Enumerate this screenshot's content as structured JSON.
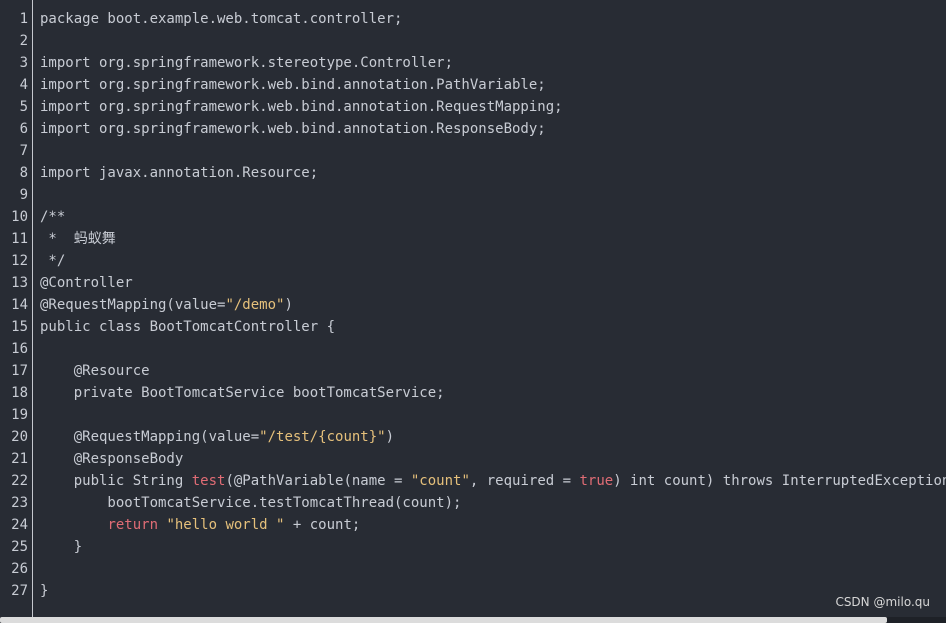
{
  "colors": {
    "background": "#282c34",
    "text": "#c8ccd4",
    "string": "#e5c07b",
    "keyword": "#e06c75",
    "gutter_border": "#c5c8ce"
  },
  "watermark": "CSDN @milo.qu",
  "lines": [
    {
      "n": "1",
      "tokens": [
        {
          "t": "package boot.example.web.tomcat.controller;",
          "c": "plain"
        }
      ]
    },
    {
      "n": "2",
      "tokens": []
    },
    {
      "n": "3",
      "tokens": [
        {
          "t": "import org.springframework.stereotype.Controller;",
          "c": "plain"
        }
      ]
    },
    {
      "n": "4",
      "tokens": [
        {
          "t": "import org.springframework.web.bind.annotation.PathVariable;",
          "c": "plain"
        }
      ]
    },
    {
      "n": "5",
      "tokens": [
        {
          "t": "import org.springframework.web.bind.annotation.RequestMapping;",
          "c": "plain"
        }
      ]
    },
    {
      "n": "6",
      "tokens": [
        {
          "t": "import org.springframework.web.bind.annotation.ResponseBody;",
          "c": "plain"
        }
      ]
    },
    {
      "n": "7",
      "tokens": []
    },
    {
      "n": "8",
      "tokens": [
        {
          "t": "import javax.annotation.Resource;",
          "c": "plain"
        }
      ]
    },
    {
      "n": "9",
      "tokens": []
    },
    {
      "n": "10",
      "tokens": [
        {
          "t": "/**",
          "c": "plain"
        }
      ]
    },
    {
      "n": "11",
      "tokens": [
        {
          "t": " *  蚂蚁舞",
          "c": "plain"
        }
      ]
    },
    {
      "n": "12",
      "tokens": [
        {
          "t": " */",
          "c": "plain"
        }
      ]
    },
    {
      "n": "13",
      "tokens": [
        {
          "t": "@Controller",
          "c": "plain"
        }
      ]
    },
    {
      "n": "14",
      "tokens": [
        {
          "t": "@RequestMapping(value=",
          "c": "plain"
        },
        {
          "t": "\"/demo\"",
          "c": "string"
        },
        {
          "t": ")",
          "c": "plain"
        }
      ]
    },
    {
      "n": "15",
      "tokens": [
        {
          "t": "public class BootTomcatController {",
          "c": "plain"
        }
      ]
    },
    {
      "n": "16",
      "tokens": []
    },
    {
      "n": "17",
      "tokens": [
        {
          "t": "    @Resource",
          "c": "plain"
        }
      ]
    },
    {
      "n": "18",
      "tokens": [
        {
          "t": "    private BootTomcatService bootTomcatService;",
          "c": "plain"
        }
      ]
    },
    {
      "n": "19",
      "tokens": []
    },
    {
      "n": "20",
      "tokens": [
        {
          "t": "    @RequestMapping(value=",
          "c": "plain"
        },
        {
          "t": "\"/test/{count}\"",
          "c": "string"
        },
        {
          "t": ")",
          "c": "plain"
        }
      ]
    },
    {
      "n": "21",
      "tokens": [
        {
          "t": "    @ResponseBody",
          "c": "plain"
        }
      ]
    },
    {
      "n": "22",
      "tokens": [
        {
          "t": "    public String ",
          "c": "plain"
        },
        {
          "t": "test",
          "c": "fn"
        },
        {
          "t": "(@PathVariable(name = ",
          "c": "plain"
        },
        {
          "t": "\"count\"",
          "c": "string"
        },
        {
          "t": ", required = ",
          "c": "plain"
        },
        {
          "t": "true",
          "c": "keyword"
        },
        {
          "t": ") int count) throws InterruptedException {",
          "c": "plain"
        }
      ]
    },
    {
      "n": "23",
      "tokens": [
        {
          "t": "        bootTomcatService.testTomcatThread(count);",
          "c": "plain"
        }
      ]
    },
    {
      "n": "24",
      "tokens": [
        {
          "t": "        ",
          "c": "plain"
        },
        {
          "t": "return",
          "c": "keyword"
        },
        {
          "t": " ",
          "c": "plain"
        },
        {
          "t": "\"hello world \"",
          "c": "string"
        },
        {
          "t": " + count;",
          "c": "plain"
        }
      ]
    },
    {
      "n": "25",
      "tokens": [
        {
          "t": "    }",
          "c": "plain"
        }
      ]
    },
    {
      "n": "26",
      "tokens": []
    },
    {
      "n": "27",
      "tokens": [
        {
          "t": "}",
          "c": "plain"
        }
      ]
    }
  ]
}
